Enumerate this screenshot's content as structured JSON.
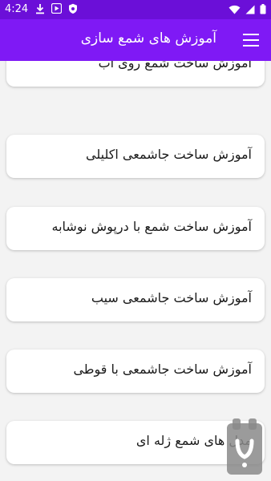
{
  "status": {
    "time": "4:24"
  },
  "app_bar": {
    "title": "آموزش های شمع سازی"
  },
  "items": [
    {
      "label": "آموزش ساخت شمع روی آب"
    },
    {
      "label": "آموزش ساخت جاشمعی اکلیلی"
    },
    {
      "label": "آموزش ساخت شمع با درپوش نوشابه"
    },
    {
      "label": "آموزش ساخت جاشمعی سیب"
    },
    {
      "label": "آموزش ساخت جاشمعی با قوطی"
    },
    {
      "label": "مدل های شمع ژله ای"
    }
  ],
  "colors": {
    "status_bar": "#6b0fd8",
    "app_bar": "#7f19f5",
    "background": "#f3f3f3"
  },
  "icons": [
    "download-icon",
    "play-protect-icon",
    "shield-icon",
    "wifi-icon",
    "signal-icon",
    "battery-icon",
    "menu-icon",
    "bazaar-logo-icon"
  ]
}
